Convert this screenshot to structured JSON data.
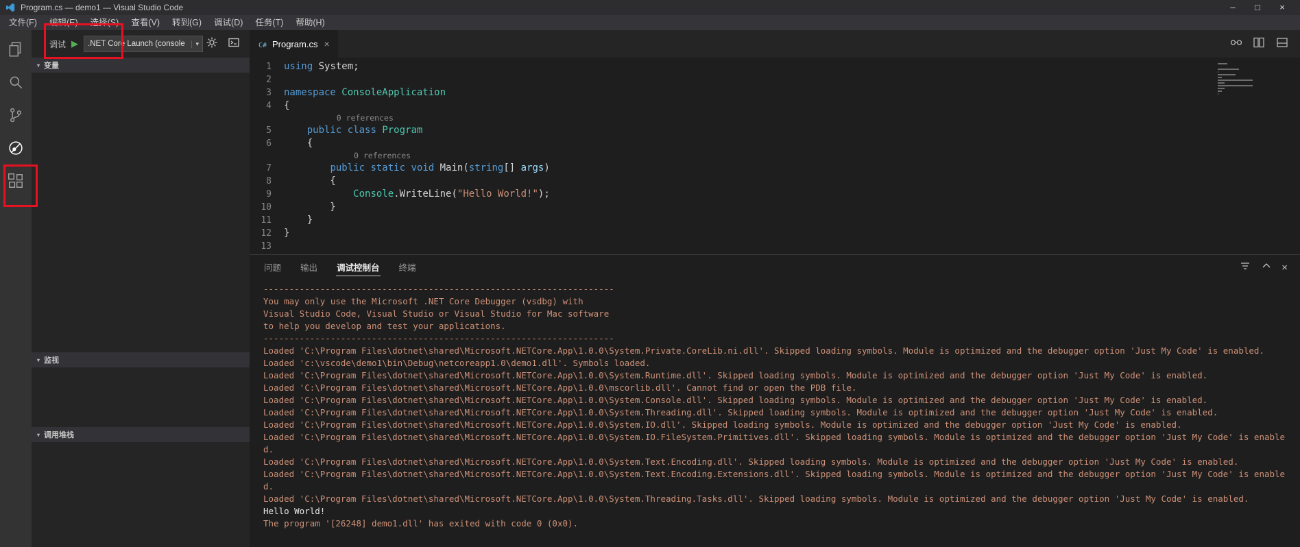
{
  "window": {
    "title": "Program.cs — demo1 — Visual Studio Code",
    "controls": {
      "minimize": "–",
      "maximize": "□",
      "close": "×"
    }
  },
  "menu": {
    "items": [
      "文件(F)",
      "编辑(E)",
      "选择(S)",
      "查看(V)",
      "转到(G)",
      "调试(D)",
      "任务(T)",
      "帮助(H)"
    ]
  },
  "activity_bar": {
    "items": [
      {
        "name": "explorer",
        "active": false
      },
      {
        "name": "search",
        "active": false
      },
      {
        "name": "source-control",
        "active": false
      },
      {
        "name": "debug",
        "active": true
      },
      {
        "name": "extensions",
        "active": false
      }
    ]
  },
  "debug_panel": {
    "toolbar": {
      "label": "调试",
      "configuration": ".NET Core Launch (console"
    },
    "sections": [
      {
        "label": "变量"
      },
      {
        "label": "监视"
      },
      {
        "label": "调用堆栈"
      }
    ]
  },
  "editor": {
    "tab": {
      "label": "Program.cs",
      "close": "×"
    },
    "codelens_label": "0 references",
    "code": {
      "lines": [
        {
          "num": "1",
          "tokens": [
            [
              "kw",
              "using"
            ],
            [
              "pl",
              " System;"
            ]
          ]
        },
        {
          "num": "2",
          "tokens": []
        },
        {
          "num": "3",
          "tokens": [
            [
              "kw",
              "namespace"
            ],
            [
              "pl",
              " "
            ],
            [
              "ty",
              "ConsoleApplication"
            ]
          ]
        },
        {
          "num": "4",
          "tokens": [
            [
              "pl",
              "{"
            ]
          ]
        },
        {
          "lens": true,
          "indent": 7
        },
        {
          "num": "5",
          "tokens": [
            [
              "pl",
              "    "
            ],
            [
              "kw",
              "public"
            ],
            [
              "pl",
              " "
            ],
            [
              "kw",
              "class"
            ],
            [
              "pl",
              " "
            ],
            [
              "ty",
              "Program"
            ]
          ]
        },
        {
          "num": "6",
          "tokens": [
            [
              "pl",
              "    {"
            ]
          ]
        },
        {
          "lens": true,
          "indent": 10
        },
        {
          "num": "7",
          "tokens": [
            [
              "pl",
              "        "
            ],
            [
              "kw",
              "public"
            ],
            [
              "pl",
              " "
            ],
            [
              "kw",
              "static"
            ],
            [
              "pl",
              " "
            ],
            [
              "kw",
              "void"
            ],
            [
              "pl",
              " Main("
            ],
            [
              "kw",
              "string"
            ],
            [
              "pl",
              "[] "
            ],
            [
              "pr",
              "args"
            ],
            [
              "pl",
              ")"
            ]
          ]
        },
        {
          "num": "8",
          "tokens": [
            [
              "pl",
              "        {"
            ]
          ]
        },
        {
          "num": "9",
          "tokens": [
            [
              "pl",
              "            "
            ],
            [
              "ty",
              "Console"
            ],
            [
              "pl",
              ".WriteLine("
            ],
            [
              "st",
              "\"Hello World!\""
            ],
            [
              "pl",
              ");"
            ]
          ]
        },
        {
          "num": "10",
          "tokens": [
            [
              "pl",
              "        }"
            ]
          ]
        },
        {
          "num": "11",
          "tokens": [
            [
              "pl",
              "    }"
            ]
          ]
        },
        {
          "num": "12",
          "tokens": [
            [
              "pl",
              "}"
            ]
          ]
        },
        {
          "num": "13",
          "tokens": []
        }
      ]
    }
  },
  "panel": {
    "tabs": [
      {
        "label": "问题",
        "active": false
      },
      {
        "label": "输出",
        "active": false
      },
      {
        "label": "调试控制台",
        "active": true
      },
      {
        "label": "终端",
        "active": false
      }
    ],
    "console": {
      "lines": [
        {
          "style": "info",
          "text": "--------------------------------------------------------------------"
        },
        {
          "style": "info",
          "text": "You may only use the Microsoft .NET Core Debugger (vsdbg) with"
        },
        {
          "style": "info",
          "text": "Visual Studio Code, Visual Studio or Visual Studio for Mac software"
        },
        {
          "style": "info",
          "text": "to help you develop and test your applications."
        },
        {
          "style": "info",
          "text": "--------------------------------------------------------------------"
        },
        {
          "style": "info",
          "text": "Loaded 'C:\\Program Files\\dotnet\\shared\\Microsoft.NETCore.App\\1.0.0\\System.Private.CoreLib.ni.dll'. Skipped loading symbols. Module is optimized and the debugger option 'Just My Code' is enabled."
        },
        {
          "style": "info",
          "text": "Loaded 'c:\\vscode\\demo1\\bin\\Debug\\netcoreapp1.0\\demo1.dll'. Symbols loaded."
        },
        {
          "style": "info",
          "text": "Loaded 'C:\\Program Files\\dotnet\\shared\\Microsoft.NETCore.App\\1.0.0\\System.Runtime.dll'. Skipped loading symbols. Module is optimized and the debugger option 'Just My Code' is enabled."
        },
        {
          "style": "info",
          "text": "Loaded 'C:\\Program Files\\dotnet\\shared\\Microsoft.NETCore.App\\1.0.0\\mscorlib.dll'. Cannot find or open the PDB file."
        },
        {
          "style": "info",
          "text": "Loaded 'C:\\Program Files\\dotnet\\shared\\Microsoft.NETCore.App\\1.0.0\\System.Console.dll'. Skipped loading symbols. Module is optimized and the debugger option 'Just My Code' is enabled."
        },
        {
          "style": "info",
          "text": "Loaded 'C:\\Program Files\\dotnet\\shared\\Microsoft.NETCore.App\\1.0.0\\System.Threading.dll'. Skipped loading symbols. Module is optimized and the debugger option 'Just My Code' is enabled."
        },
        {
          "style": "info",
          "text": "Loaded 'C:\\Program Files\\dotnet\\shared\\Microsoft.NETCore.App\\1.0.0\\System.IO.dll'. Skipped loading symbols. Module is optimized and the debugger option 'Just My Code' is enabled."
        },
        {
          "style": "info",
          "text": "Loaded 'C:\\Program Files\\dotnet\\shared\\Microsoft.NETCore.App\\1.0.0\\System.IO.FileSystem.Primitives.dll'. Skipped loading symbols. Module is optimized and the debugger option 'Just My Code' is enabled."
        },
        {
          "style": "info",
          "text": "Loaded 'C:\\Program Files\\dotnet\\shared\\Microsoft.NETCore.App\\1.0.0\\System.Text.Encoding.dll'. Skipped loading symbols. Module is optimized and the debugger option 'Just My Code' is enabled."
        },
        {
          "style": "info",
          "text": "Loaded 'C:\\Program Files\\dotnet\\shared\\Microsoft.NETCore.App\\1.0.0\\System.Text.Encoding.Extensions.dll'. Skipped loading symbols. Module is optimized and the debugger option 'Just My Code' is enabled."
        },
        {
          "style": "info",
          "text": "Loaded 'C:\\Program Files\\dotnet\\shared\\Microsoft.NETCore.App\\1.0.0\\System.Threading.Tasks.dll'. Skipped loading symbols. Module is optimized and the debugger option 'Just My Code' is enabled."
        },
        {
          "style": "stdout",
          "text": "Hello World!"
        },
        {
          "style": "info",
          "text": "The program '[26248] demo1.dll' has exited with code 0 (0x0)."
        }
      ]
    }
  },
  "icons": {
    "play": "▶",
    "twisty": "▾",
    "dropdown_arrow": "▾",
    "close_x": "×"
  },
  "colors": {
    "annotation": "#e81123",
    "keyword": "#569cd6",
    "type_name": "#4ec9b0",
    "string": "#ce9178",
    "plain": "#d4d4d4",
    "parameter": "#9cdcfe",
    "console_info": "#ce9178",
    "console_stdout": "#e8e8e8",
    "play_button": "#54b054"
  }
}
